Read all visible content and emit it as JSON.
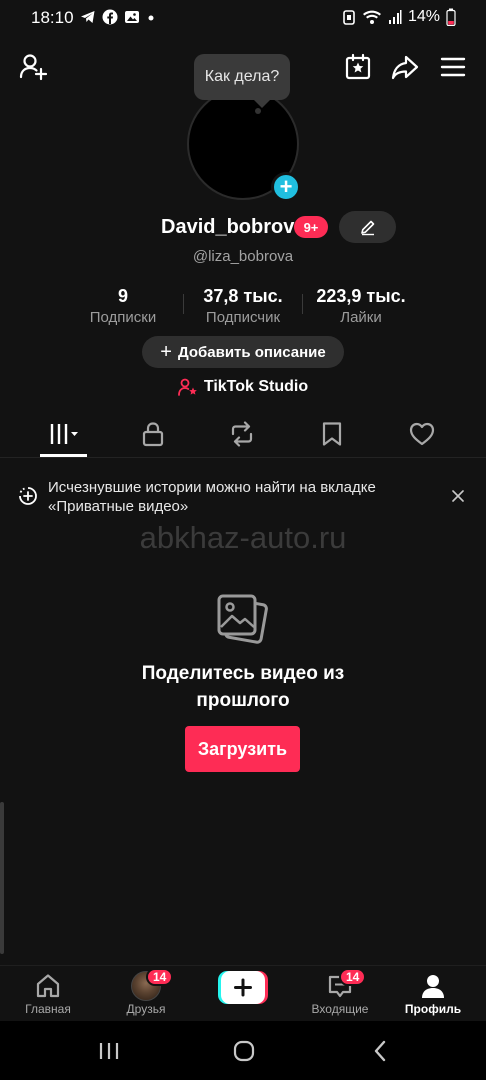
{
  "status_bar": {
    "time": "18:10",
    "left_icons": [
      "telegram-icon",
      "facebook-icon",
      "gallery-icon",
      "dot-icon"
    ],
    "right_icons": [
      "alarm-icon",
      "wifi-icon",
      "signal-icon",
      "battery-icon"
    ],
    "battery": "14%"
  },
  "top_bar": {
    "left_icon": "add-friend-icon",
    "right_icons": [
      "calendar-star-icon",
      "share-icon",
      "menu-icon"
    ]
  },
  "tooltip": {
    "text": "Как дела?"
  },
  "profile": {
    "display_name": "David_bobrov",
    "name_badge": "9+",
    "username": "@liza_bobrova"
  },
  "stats": [
    {
      "value": "9",
      "label": "Подписки"
    },
    {
      "value": "37,8 тыс.",
      "label": "Подписчик"
    },
    {
      "value": "223,9 тыс.",
      "label": "Лайки"
    }
  ],
  "add_description": {
    "icon": "+",
    "label": "Добавить описание"
  },
  "studio": {
    "label": "TikTok Studio"
  },
  "tabs": [
    {
      "icon": "grid-icon",
      "active": true
    },
    {
      "icon": "lock-icon",
      "active": false
    },
    {
      "icon": "repost-icon",
      "active": false
    },
    {
      "icon": "bookmark-icon",
      "active": false
    },
    {
      "icon": "heart-icon",
      "active": false
    }
  ],
  "banner": {
    "text_line1": "Исчезнувшие истории можно найти на вкладке",
    "text_line2": "«Приватные видео»"
  },
  "watermark": "abkhaz-auto.ru",
  "empty_state": {
    "line1": "Поделитесь видео из",
    "line2": "прошлого",
    "button": "Загрузить"
  },
  "bottom_nav": {
    "items": [
      {
        "label": "Главная",
        "icon": "home-icon"
      },
      {
        "label": "Друзья",
        "icon": "friend-avatar",
        "badge": "14"
      },
      {
        "label": "",
        "icon": "create-plus-icon"
      },
      {
        "label": "Входящие",
        "icon": "inbox-icon",
        "badge": "14"
      },
      {
        "label": "Профиль",
        "icon": "profile-icon",
        "active": true
      }
    ]
  },
  "colors": {
    "background": "#121212",
    "accent": "#fe2c55",
    "avatar_plus": "#20bfe0"
  }
}
